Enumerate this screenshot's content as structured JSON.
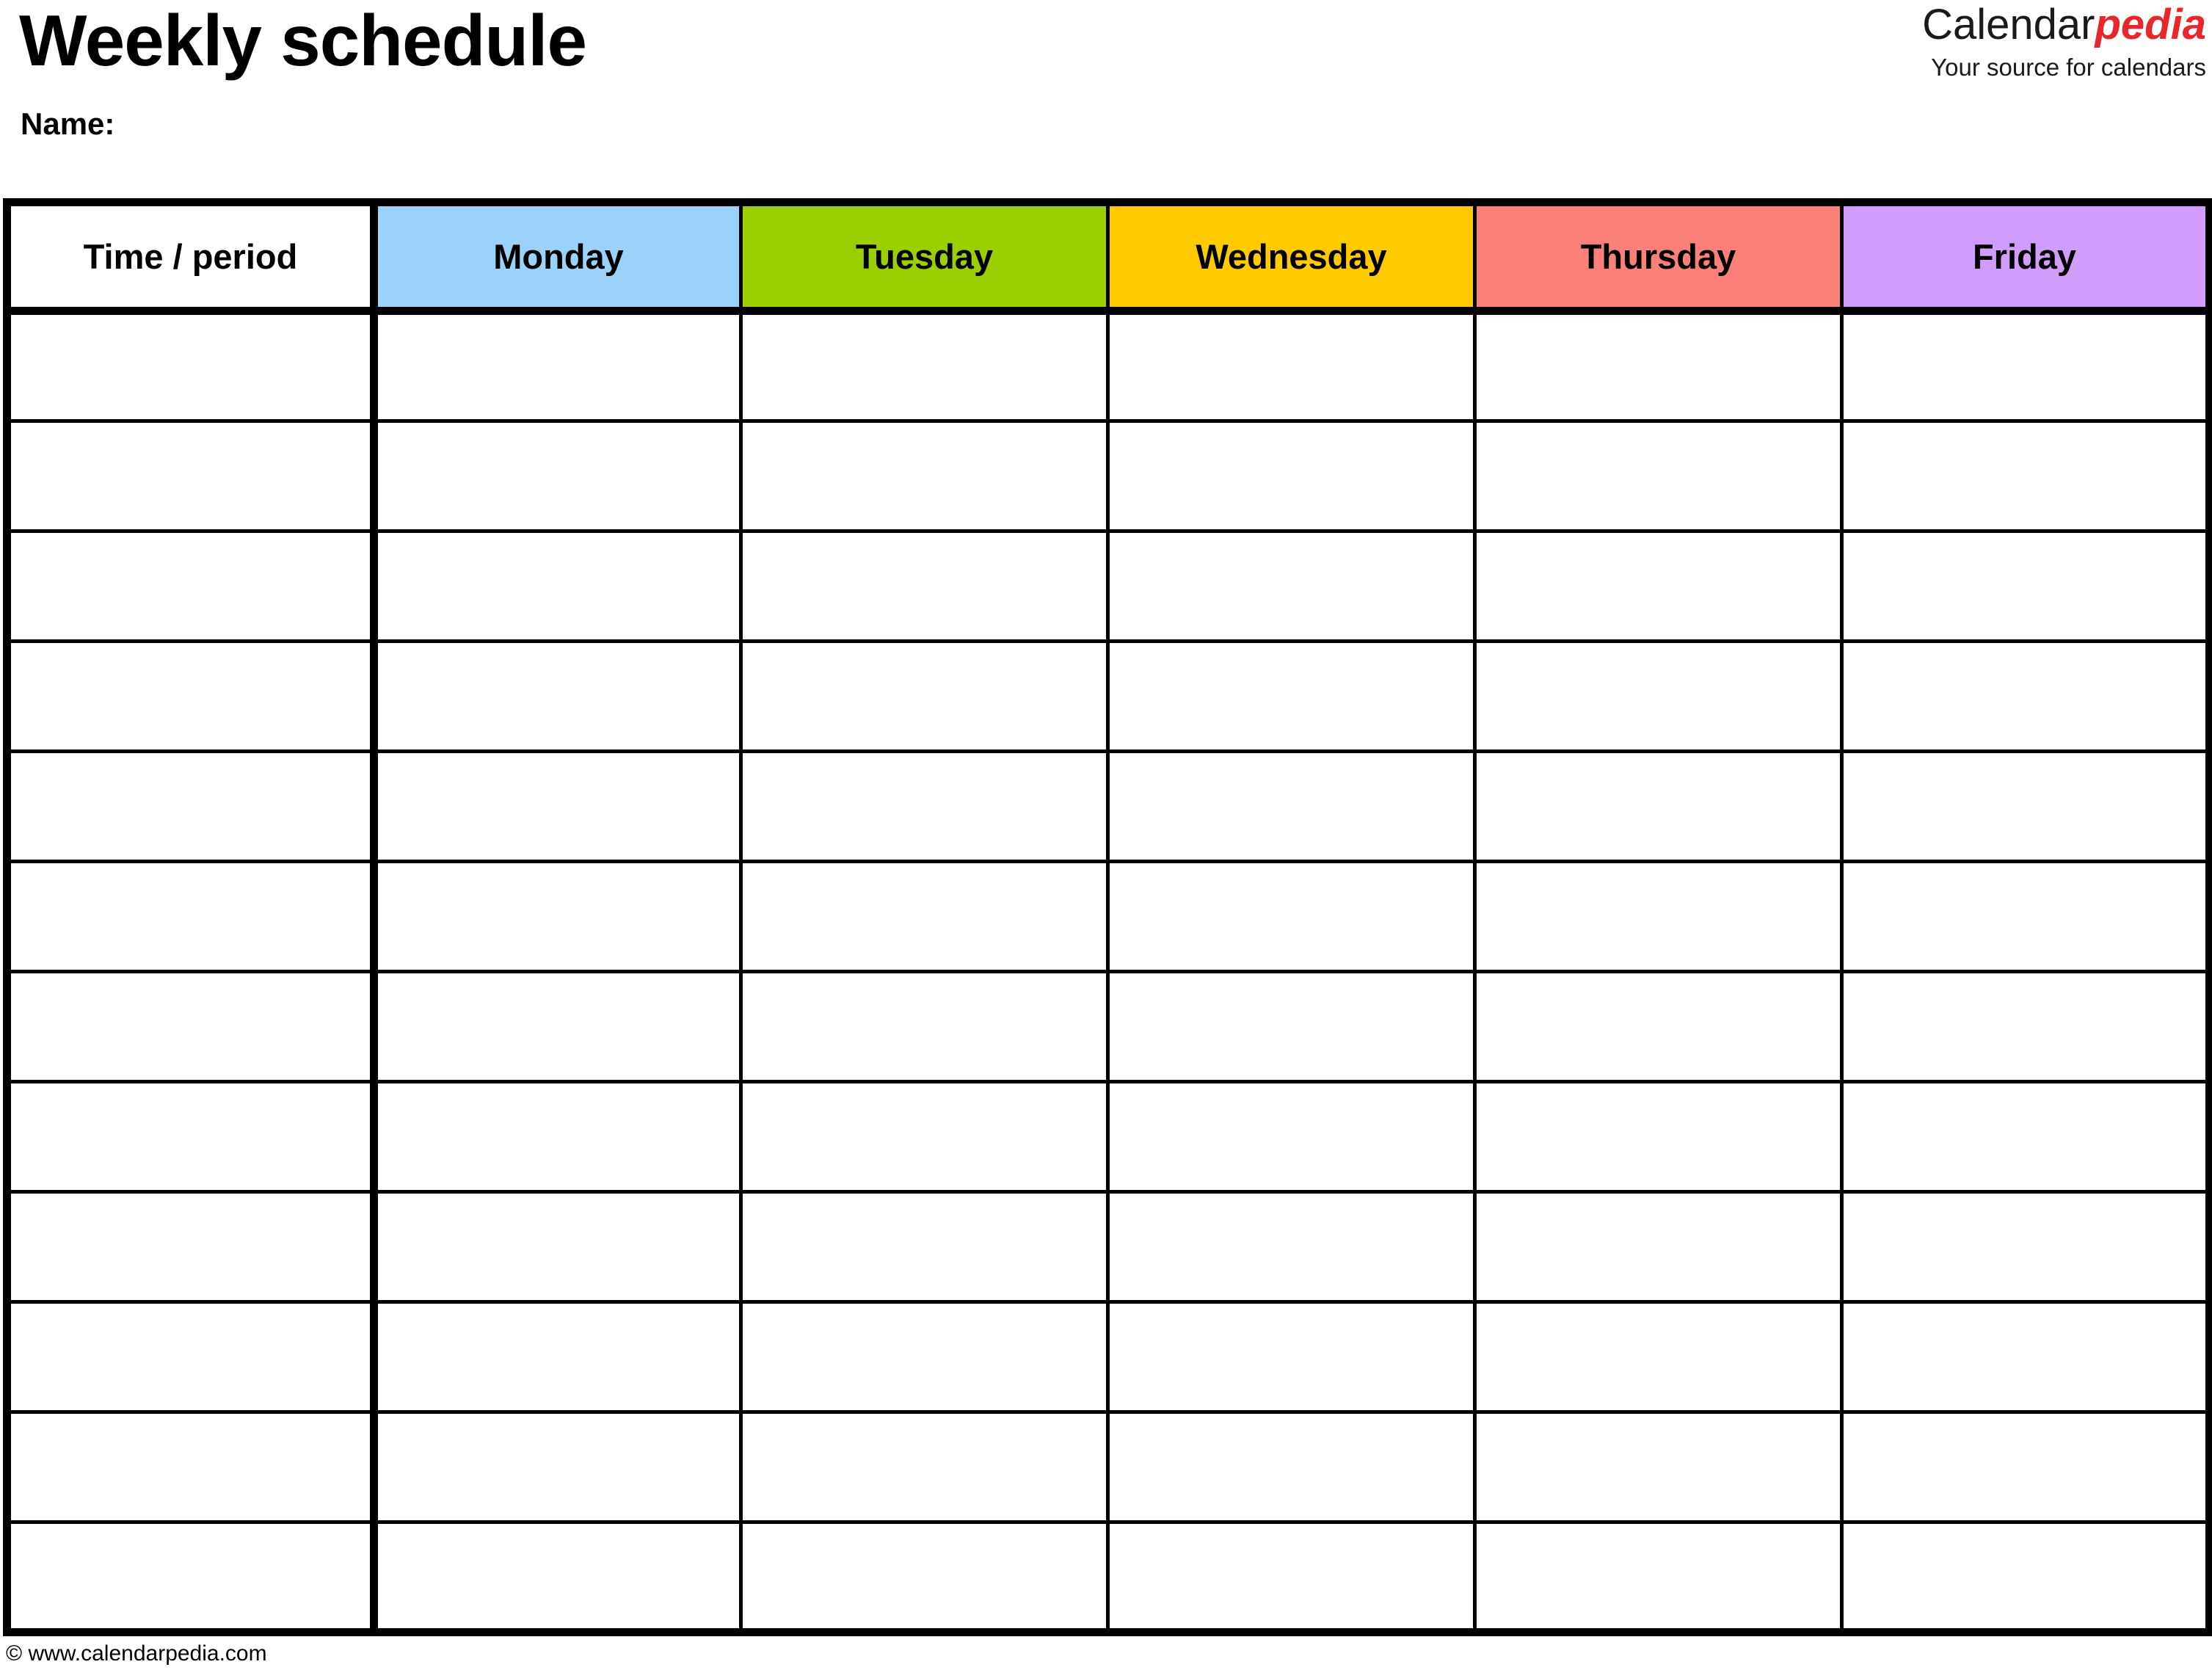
{
  "document": {
    "title": "Weekly schedule",
    "name_label": "Name:"
  },
  "brand": {
    "name_part1": "Calendar",
    "name_part2": "pedia",
    "tagline": "Your source for calendars",
    "accent_color": "#e8272c",
    "text_color": "#1a1a1a"
  },
  "table": {
    "columns": [
      {
        "label": "Time / period",
        "color": "#ffffff"
      },
      {
        "label": "Monday",
        "color": "#9bd2fa"
      },
      {
        "label": "Tuesday",
        "color": "#9bd000"
      },
      {
        "label": "Wednesday",
        "color": "#ffca00"
      },
      {
        "label": "Thursday",
        "color": "#fb8079"
      },
      {
        "label": "Friday",
        "color": "#d29cfd"
      }
    ],
    "row_count": 12,
    "rows": [
      [
        "",
        "",
        "",
        "",
        "",
        ""
      ],
      [
        "",
        "",
        "",
        "",
        "",
        ""
      ],
      [
        "",
        "",
        "",
        "",
        "",
        ""
      ],
      [
        "",
        "",
        "",
        "",
        "",
        ""
      ],
      [
        "",
        "",
        "",
        "",
        "",
        ""
      ],
      [
        "",
        "",
        "",
        "",
        "",
        ""
      ],
      [
        "",
        "",
        "",
        "",
        "",
        ""
      ],
      [
        "",
        "",
        "",
        "",
        "",
        ""
      ],
      [
        "",
        "",
        "",
        "",
        "",
        ""
      ],
      [
        "",
        "",
        "",
        "",
        "",
        ""
      ],
      [
        "",
        "",
        "",
        "",
        "",
        ""
      ],
      [
        "",
        "",
        "",
        "",
        "",
        ""
      ]
    ]
  },
  "footer": {
    "copyright": "© www.calendarpedia.com"
  }
}
